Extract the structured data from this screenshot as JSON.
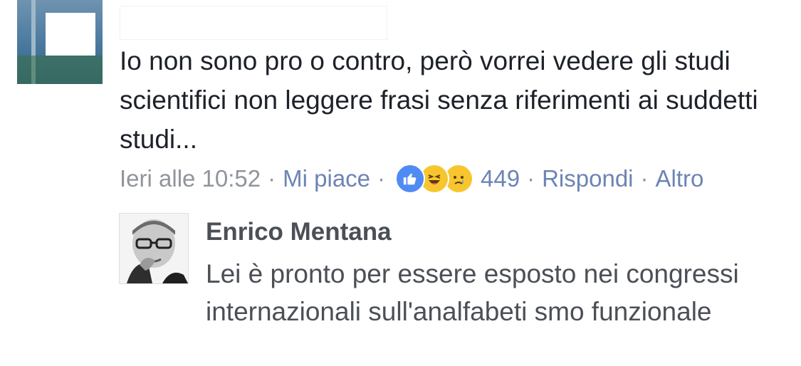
{
  "comment": {
    "author_name": "",
    "text": "Io non sono pro o contro, però vorrei vedere gli studi scientifici non leggere frasi senza riferimenti ai suddetti studi...",
    "timestamp": "Ieri alle 10:52",
    "like_label": "Mi piace",
    "reaction_icons": [
      "like-icon",
      "haha-icon",
      "sad-icon"
    ],
    "reaction_count": "449",
    "reply_label": "Rispondi",
    "more_label": "Altro"
  },
  "reply": {
    "author_name": "Enrico Mentana",
    "text": "Lei è pronto per essere esposto nei congressi internazionali sull'analfabeti smo funzionale"
  },
  "colors": {
    "link": "#6d84b4",
    "meta": "#90949c",
    "text": "#1d2129",
    "reply_text": "#4b4f56",
    "like_blue": "#4f8bf3",
    "emoji_yellow": "#f7c62f"
  }
}
